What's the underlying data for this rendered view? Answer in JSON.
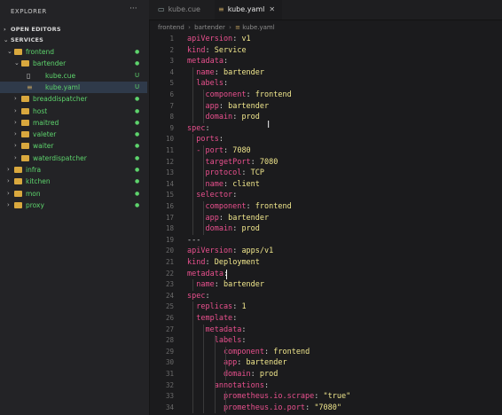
{
  "sidebar": {
    "title": "EXPLORER",
    "more": "···",
    "open_editors": "OPEN EDITORS",
    "services": "SERVICES",
    "items": [
      {
        "label": "frontend",
        "status": "●",
        "kind": "folder",
        "open": true
      },
      {
        "label": "bartender",
        "status": "●",
        "kind": "folder",
        "open": true
      },
      {
        "label": "kube.cue",
        "status": "U",
        "kind": "file-cue"
      },
      {
        "label": "kube.yaml",
        "status": "U",
        "kind": "file-yaml",
        "selected": true
      },
      {
        "label": "breaddispatcher",
        "status": "●",
        "kind": "folder"
      },
      {
        "label": "host",
        "status": "●",
        "kind": "folder"
      },
      {
        "label": "maitred",
        "status": "●",
        "kind": "folder"
      },
      {
        "label": "valeter",
        "status": "●",
        "kind": "folder"
      },
      {
        "label": "waiter",
        "status": "●",
        "kind": "folder"
      },
      {
        "label": "waterdispatcher",
        "status": "●",
        "kind": "folder"
      },
      {
        "label": "infra",
        "status": "●",
        "kind": "folder"
      },
      {
        "label": "kitchen",
        "status": "●",
        "kind": "folder"
      },
      {
        "label": "mon",
        "status": "●",
        "kind": "folder"
      },
      {
        "label": "proxy",
        "status": "●",
        "kind": "folder"
      }
    ]
  },
  "tabs": [
    {
      "label": "kube.cue",
      "active": false
    },
    {
      "label": "kube.yaml",
      "active": true,
      "close": "✕"
    }
  ],
  "breadcrumb": [
    "frontend",
    "bartender",
    "kube.yaml"
  ],
  "breadcrumb_sep": "›",
  "editor": {
    "lines": [
      {
        "n": "1",
        "key": "apiVersion",
        "val": "v1"
      },
      {
        "n": "2",
        "key": "kind",
        "val": "Service"
      },
      {
        "n": "3",
        "key": "metadata",
        "val": ""
      },
      {
        "n": "4",
        "key": "  name",
        "val": "bartender"
      },
      {
        "n": "5",
        "key": "  labels",
        "val": ""
      },
      {
        "n": "6",
        "key": "    component",
        "val": "frontend"
      },
      {
        "n": "7",
        "key": "    app",
        "val": "bartender"
      },
      {
        "n": "8",
        "key": "    domain",
        "val": "prod"
      },
      {
        "n": "9",
        "key": "spec",
        "val": ""
      },
      {
        "n": "10",
        "key": "  ports",
        "val": ""
      },
      {
        "n": "11",
        "key": "  - port",
        "val": "7080"
      },
      {
        "n": "12",
        "key": "    targetPort",
        "val": "7080"
      },
      {
        "n": "13",
        "key": "    protocol",
        "val": "TCP"
      },
      {
        "n": "14",
        "key": "    name",
        "val": "client"
      },
      {
        "n": "15",
        "key": "  selector",
        "val": ""
      },
      {
        "n": "16",
        "key": "    component",
        "val": "frontend"
      },
      {
        "n": "17",
        "key": "    app",
        "val": "bartender"
      },
      {
        "n": "18",
        "key": "    domain",
        "val": "prod"
      },
      {
        "n": "19",
        "raw": "---"
      },
      {
        "n": "20",
        "key": "apiVersion",
        "val": "apps/v1"
      },
      {
        "n": "21",
        "key": "kind",
        "val": "Deployment"
      },
      {
        "n": "22",
        "key": "metadata",
        "val": ""
      },
      {
        "n": "23",
        "key": "  name",
        "val": "bartender"
      },
      {
        "n": "24",
        "key": "spec",
        "val": ""
      },
      {
        "n": "25",
        "key": "  replicas",
        "val": "1"
      },
      {
        "n": "26",
        "key": "  template",
        "val": ""
      },
      {
        "n": "27",
        "key": "    metadata",
        "val": ""
      },
      {
        "n": "28",
        "key": "      labels",
        "val": ""
      },
      {
        "n": "29",
        "key": "        component",
        "val": "frontend"
      },
      {
        "n": "30",
        "key": "        app",
        "val": "bartender"
      },
      {
        "n": "31",
        "key": "        domain",
        "val": "prod"
      },
      {
        "n": "32",
        "key": "      annotations",
        "val": ""
      },
      {
        "n": "33",
        "key": "        prometheus.io.scrape",
        "val": "\"true\""
      },
      {
        "n": "34",
        "key": "        prometheus.io.port",
        "val": "\"7080\""
      }
    ]
  },
  "colors": {
    "key": "#e9508e",
    "value": "#f0e68c",
    "git_added": "#5dd36c",
    "folder": "#d9a83e"
  }
}
